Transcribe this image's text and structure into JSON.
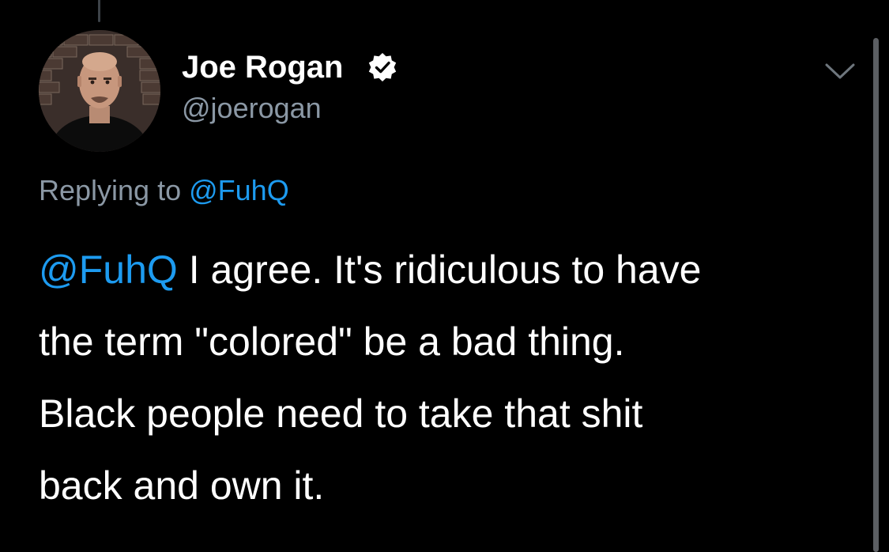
{
  "tweet": {
    "author": {
      "display_name": "Joe Rogan",
      "handle": "@joerogan",
      "verified": true
    },
    "replying_to": {
      "prefix": "Replying to",
      "mention": "@FuhQ"
    },
    "body": {
      "mention": "@FuhQ",
      "lines": [
        " I agree. It's ridiculous to have",
        "the term \"colored\" be a bad thing.",
        "Black people need to take that shit",
        "back and own it."
      ]
    },
    "icons": {
      "verified": "verified-badge-icon",
      "menu": "chevron-down-icon"
    }
  },
  "colors": {
    "background": "#000000",
    "text_primary": "#ffffff",
    "text_secondary": "#8b98a5",
    "link": "#1d9bf0"
  }
}
